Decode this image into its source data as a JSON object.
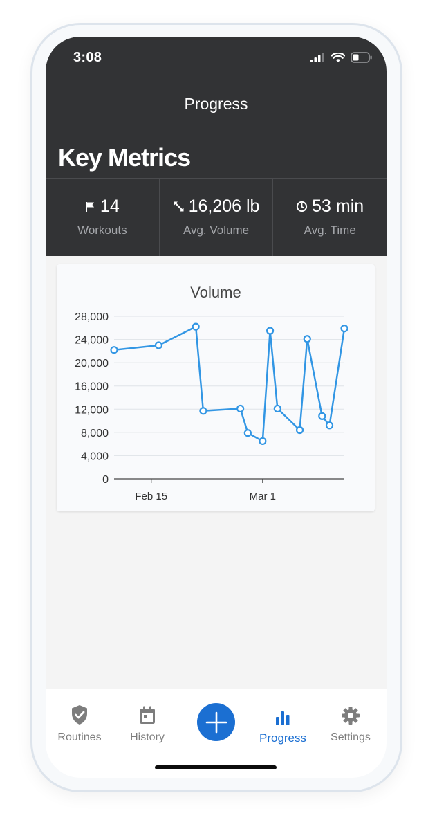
{
  "status_bar": {
    "time": "3:08"
  },
  "header": {
    "title": "Progress",
    "section_title": "Key Metrics"
  },
  "metrics": [
    {
      "icon": "flag-icon",
      "value": "14",
      "label": "Workouts"
    },
    {
      "icon": "arrows-icon",
      "value": "16,206 lb",
      "label": "Avg. Volume"
    },
    {
      "icon": "clock-icon",
      "value": "53 min",
      "label": "Avg. Time"
    }
  ],
  "chart_data": {
    "type": "line",
    "title": "Volume",
    "xlabel": "",
    "ylabel": "",
    "ylim": [
      0,
      28000
    ],
    "yticks": [
      "0",
      "4,000",
      "8,000",
      "12,000",
      "16,000",
      "20,000",
      "24,000",
      "28,000"
    ],
    "xticks": [
      {
        "label": "Feb 15",
        "x": "2024-02-15"
      },
      {
        "label": "Mar 1",
        "x": "2024-03-01"
      }
    ],
    "grid": true,
    "color": "#3296e4",
    "points": [
      {
        "x": "2024-02-10",
        "y": 22200
      },
      {
        "x": "2024-02-16",
        "y": 23000
      },
      {
        "x": "2024-02-21",
        "y": 26200
      },
      {
        "x": "2024-02-22",
        "y": 11700
      },
      {
        "x": "2024-02-27",
        "y": 12100
      },
      {
        "x": "2024-02-28",
        "y": 7900
      },
      {
        "x": "2024-03-01",
        "y": 6500
      },
      {
        "x": "2024-03-02",
        "y": 25500
      },
      {
        "x": "2024-03-03",
        "y": 12100
      },
      {
        "x": "2024-03-06",
        "y": 8400
      },
      {
        "x": "2024-03-07",
        "y": 24100
      },
      {
        "x": "2024-03-09",
        "y": 10800
      },
      {
        "x": "2024-03-10",
        "y": 9200
      },
      {
        "x": "2024-03-12",
        "y": 25900
      }
    ]
  },
  "tabbar": {
    "routines": "Routines",
    "history": "History",
    "progress": "Progress",
    "settings": "Settings",
    "active_color": "#1b6fd2",
    "inactive_color": "#7d7d7d"
  }
}
